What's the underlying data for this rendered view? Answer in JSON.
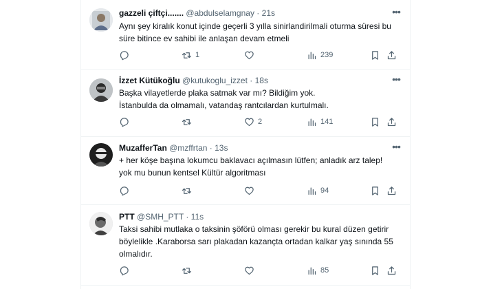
{
  "tweets": [
    {
      "name": "gazzeli çiftçi.......",
      "handle": "@abdulselamgnay",
      "dot": "·",
      "time": "21s",
      "lines": [
        "Aynı şey kiralık konut içinde geçerli 3 yılla sinirlandirilmali oturma süresi bu",
        "süre bitince ev sahibi ile anlaşan devam etmeli"
      ],
      "replies": "",
      "retweets": "1",
      "likes": "",
      "views": "239"
    },
    {
      "name": "İzzet Kütükoğlu",
      "handle": "@kutukoglu_izzet",
      "dot": "·",
      "time": "18s",
      "lines": [
        "Başka vilayetlerde plaka satmak var mı? Bildiğim yok.",
        "İstanbulda da olmamalı, vatandaş rantcılardan kurtulmalı."
      ],
      "replies": "",
      "retweets": "",
      "likes": "2",
      "views": "141"
    },
    {
      "name": "MuzafferTan",
      "handle": "@mzffrtan",
      "dot": "·",
      "time": "13s",
      "lines": [
        "+ her köşe başına lokumcu baklavacı açılmasın lütfen; anladık arz talep!",
        "yok mu bunun kentsel Kültür algoritması"
      ],
      "replies": "",
      "retweets": "",
      "likes": "",
      "views": "94"
    },
    {
      "name": "PTT",
      "handle": "@SMH_PTT",
      "dot": "·",
      "time": "11s",
      "lines": [
        "Taksi sahibi mutlaka o taksinin şöförü olması gerekir bu kural düzen getirir",
        "böylelikle .Karaborsa sarı plakadan kazançta ortadan kalkar yaş sınında 55",
        "olmalıdır."
      ],
      "replies": "",
      "retweets": "",
      "likes": "",
      "views": "85"
    }
  ],
  "icons": {
    "more": "more-icon",
    "reply": "reply-icon",
    "retweet": "retweet-icon",
    "like": "heart-icon",
    "views": "views-icon",
    "bookmark": "bookmark-icon",
    "share": "share-icon"
  },
  "colors": {
    "text": "#0f1419",
    "muted": "#536471",
    "border": "#eff3f4"
  }
}
